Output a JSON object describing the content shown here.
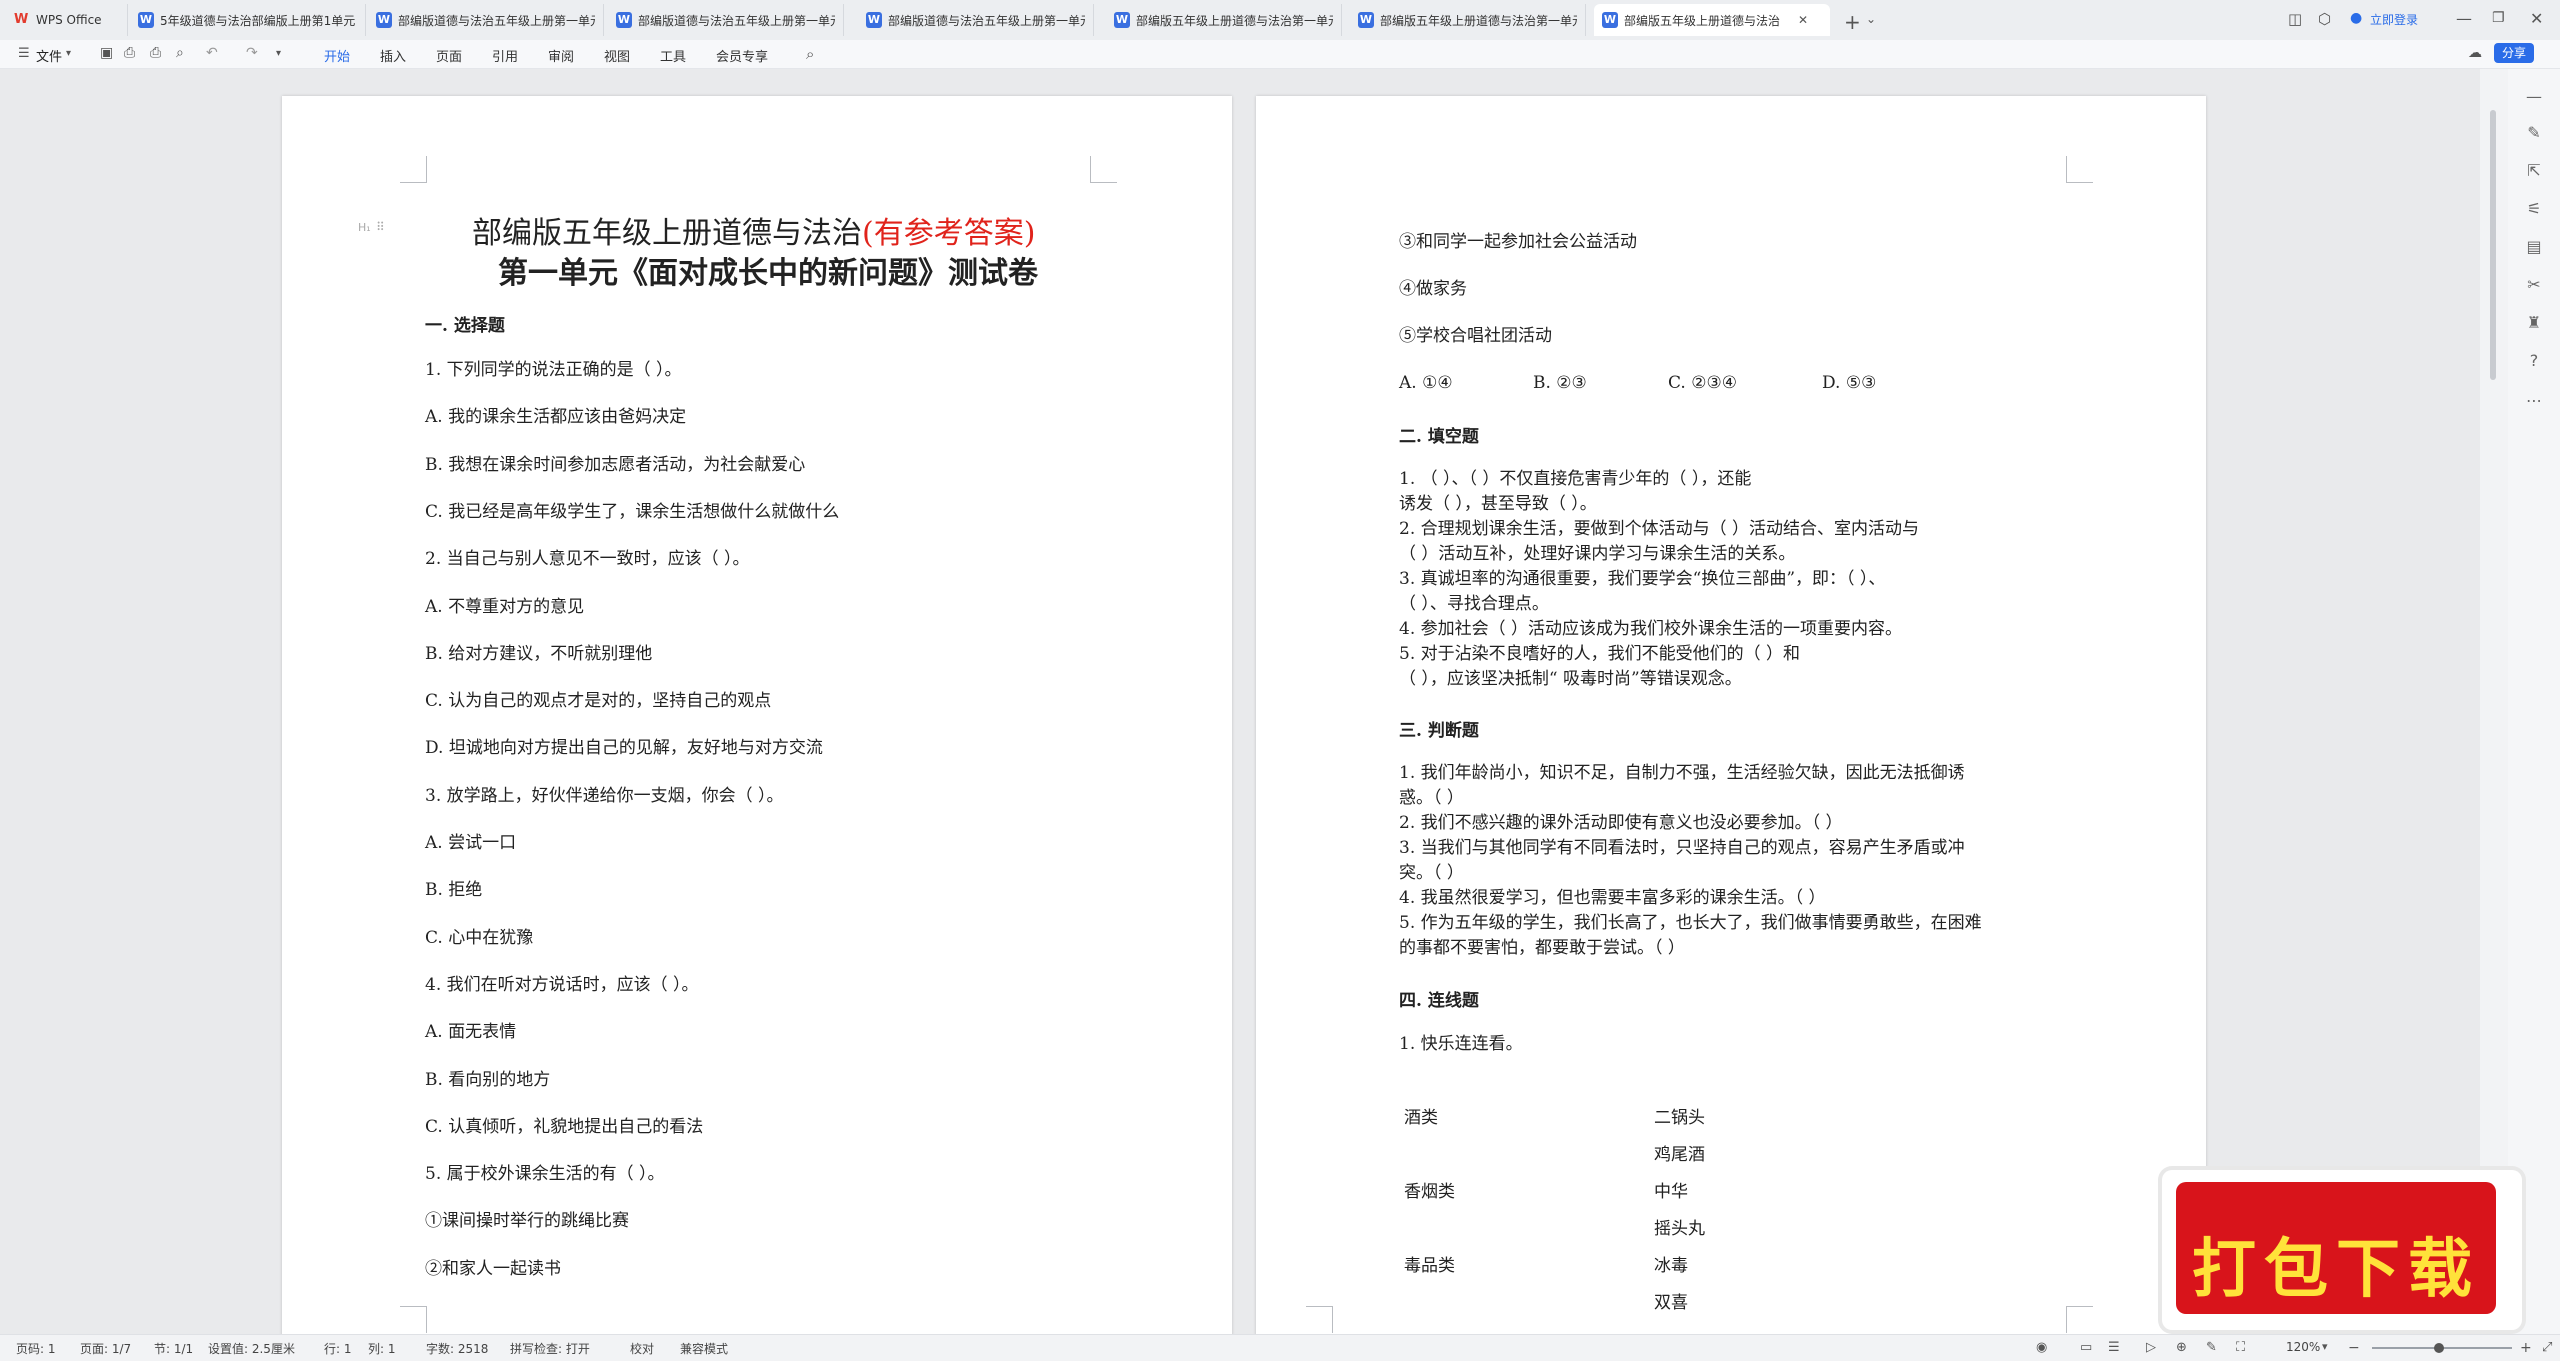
{
  "tabs": [
    {
      "label": "WPS Office"
    },
    {
      "label": "5年级道德与法治部编版上册第1单元"
    },
    {
      "label": "部编版道德与法治五年级上册第一单元"
    },
    {
      "label": "部编版道德与法治五年级上册第一单元"
    },
    {
      "label": "部编版道德与法治五年级上册第一单元"
    },
    {
      "label": "部编版五年级上册道德与法治第一单元"
    },
    {
      "label": "部编版五年级上册道德与法治第一单元"
    },
    {
      "label": "部编版五年级上册道德与法治"
    }
  ],
  "tabbar": {
    "login": "立即登录"
  },
  "toolbar": {
    "file": "文件",
    "menus": [
      "开始",
      "插入",
      "页面",
      "引用",
      "审阅",
      "视图",
      "工具",
      "会员专享"
    ],
    "share": "分享"
  },
  "page1": {
    "heading_marker": "H₁",
    "title_black": "部编版五年级上册道德与法治",
    "title_red": "(有参考答案)",
    "subtitle": "第一单元《面对成长中的新问题》测试卷",
    "section1": "一. 选择题",
    "lines": [
      "1. 下列同学的说法正确的是（        ）。",
      "A. 我的课余生活都应该由爸妈决定",
      "B. 我想在课余时间参加志愿者活动，为社会献爱心",
      "C. 我已经是高年级学生了，课余生活想做什么就做什么",
      "2. 当自己与别人意见不一致时，应该（        ）。",
      "A. 不尊重对方的意见",
      "B. 给对方建议，不听就别理他",
      "C. 认为自己的观点才是对的，坚持自己的观点",
      "D. 坦诚地向对方提出自己的见解，友好地与对方交流",
      "3. 放学路上，好伙伴递给你一支烟，你会（        ）。",
      "A. 尝试一口",
      "B. 拒绝",
      "C. 心中在犹豫",
      "4. 我们在听对方说话时，应该（        ）。",
      "A. 面无表情",
      "B. 看向别的地方",
      "C. 认真倾听，礼貌地提出自己的看法",
      "5. 属于校外课余生活的有（        ）。",
      "①课间操时举行的跳绳比赛",
      "②和家人一起读书"
    ]
  },
  "page2": {
    "top_lines": [
      "③和同学一起参加社会公益活动",
      "④做家务",
      "⑤学校合唱社团活动"
    ],
    "choices": [
      "A. ①④",
      "B. ②③",
      "C. ②③④",
      "D. ⑤③"
    ],
    "section2": "二. 填空题",
    "fill_lines": [
      "1. （            ）、（            ）不仅直接危害青少年的（            ），还能",
      "诱发（            ），甚至导致（            ）。",
      "2. 合理规划课余生活，要做到个体活动与（            ）活动结合、室内活动与",
      "（            ）活动互补，处理好课内学习与课余生活的关系。",
      "3. 真诚坦率的沟通很重要，我们要学会“换位三部曲”，即：（            ）、",
      "（            ）、寻找合理点。",
      "4. 参加社会（            ）活动应该成为我们校外课余生活的一项重要内容。",
      "5. 对于沾染不良嗜好的人，我们不能受他们的（            ）和",
      "（            ），应该坚决抵制“ 吸毒时尚”等错误观念。"
    ],
    "section3": "三. 判断题",
    "judge_lines": [
      "1. 我们年龄尚小，知识不足，自制力不强，生活经验欠缺，因此无法抵御诱",
      "惑。（        ）",
      "2. 我们不感兴趣的课外活动即使有意义也没必要参加。（        ）",
      "3. 当我们与其他同学有不同看法时，只坚持自己的观点，容易产生矛盾或冲",
      "突。（        ）",
      "4. 我虽然很爱学习，但也需要丰富多彩的课余生活。（        ）",
      "5. 作为五年级的学生，我们长高了，也长大了，我们做事情要勇敢些，在困难",
      "的事都不要害怕，都要敢于尝试。（        ）"
    ],
    "section4": "四. 连线题",
    "match_intro": "1. 快乐连连看。",
    "match_left": [
      "酒类",
      "",
      "香烟类",
      "",
      "毒品类",
      ""
    ],
    "match_right": [
      "二锅头",
      "鸡尾酒",
      "中华",
      "摇头丸",
      "冰毒",
      "双喜"
    ]
  },
  "status": {
    "page": "页码: 1",
    "pages": "页面: 1/7",
    "section": "节: 1/1",
    "setting": "设置值: 2.5厘米",
    "row": "行: 1",
    "col": "列: 1",
    "words": "字数: 2518",
    "spell": "拼写检查: 打开",
    "proof": "校对",
    "compat": "兼容模式",
    "zoom": "120%"
  },
  "ad": {
    "text": "打包下载"
  }
}
